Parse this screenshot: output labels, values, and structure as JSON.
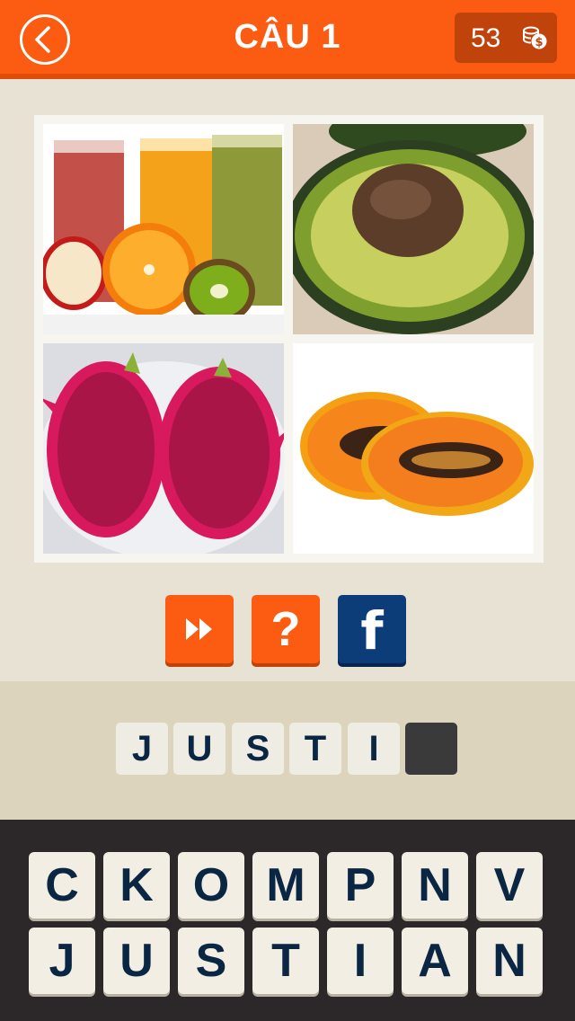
{
  "header": {
    "title": "CÂU 1",
    "coins": "53"
  },
  "colors": {
    "brand_orange": "#fc5b12",
    "facebook_blue": "#0d3d78",
    "letter_text": "#0b2643",
    "keyboard_bg": "#2c2729"
  },
  "actions": {
    "skip_icon": "fast-forward-icon",
    "hint_label": "?",
    "facebook_label": "f"
  },
  "photos": [
    "juice-and-fruits",
    "avocado-half",
    "dragon-fruit-halves",
    "papaya-halves"
  ],
  "answer": {
    "slots": [
      "J",
      "U",
      "S",
      "T",
      "I",
      ""
    ]
  },
  "keyboard": {
    "row1": [
      "C",
      "K",
      "O",
      "M",
      "P",
      "N",
      "V"
    ],
    "row2": [
      "J",
      "U",
      "S",
      "T",
      "I",
      "A",
      "N"
    ]
  }
}
